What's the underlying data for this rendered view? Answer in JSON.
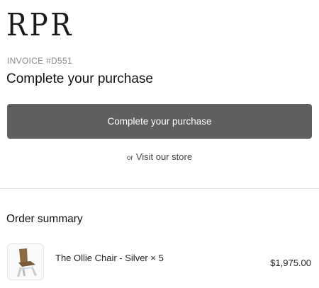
{
  "brand": {
    "logo_text": "RPR"
  },
  "invoice": {
    "label": "INVOICE #D551"
  },
  "page": {
    "title": "Complete your purchase"
  },
  "actions": {
    "primary_label": "Complete your purchase",
    "or_text": "or",
    "store_link_label": "Visit our store"
  },
  "summary": {
    "title": "Order summary",
    "items": [
      {
        "name": "The Ollie Chair - Silver × 5",
        "price": "$1,975.00",
        "thumbnail_icon": "chair-icon"
      }
    ]
  },
  "colors": {
    "button_bg": "#5f5f5f",
    "button_text": "#ffffff",
    "muted_text": "#8a8a8a",
    "divider": "#e2e2e2"
  }
}
